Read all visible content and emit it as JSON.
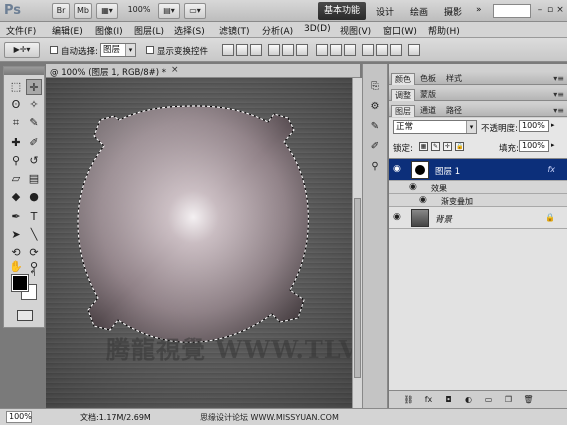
{
  "appbar": {
    "logo": "Ps",
    "bridge": "Br",
    "minibridge": "Mb",
    "zoom": "100%",
    "workspace_active": "基本功能",
    "workspaces": [
      "设计",
      "绘画",
      "摄影"
    ],
    "more": "»"
  },
  "menu": [
    "文件(F)",
    "编辑(E)",
    "图像(I)",
    "图层(L)",
    "选择(S)",
    "滤镜(T)",
    "分析(A)",
    "3D(D)",
    "视图(V)",
    "窗口(W)",
    "帮助(H)"
  ],
  "options": {
    "auto_select_label": "自动选择:",
    "auto_select_value": "图层",
    "show_transform_label": "显示变换控件"
  },
  "document": {
    "tab_title": "@ 100% (图层 1, RGB/8#) *",
    "close": "×",
    "watermark": "腾龍視覺 WWW.TLVI.NET"
  },
  "status": {
    "zoom": "100%",
    "doc_size": "文档:1.17M/2.69M",
    "credit": "思缘设计论坛 WWW.MISSYUAN.COM"
  },
  "panels": {
    "row1_tabs": [
      "颜色",
      "色板",
      "样式"
    ],
    "row2_tabs": [
      "调整",
      "蒙版"
    ],
    "row3_tabs": [
      "图层",
      "通道",
      "路径"
    ],
    "blend_mode": "正常",
    "opacity_label": "不透明度:",
    "opacity": "100%",
    "lock_label": "锁定:",
    "fill_label": "填充:",
    "fill": "100%",
    "layers": {
      "layer1": "图层 1",
      "fx": "fx",
      "effects": "效果",
      "gradient_overlay": "渐变叠加",
      "background": "背景"
    }
  }
}
